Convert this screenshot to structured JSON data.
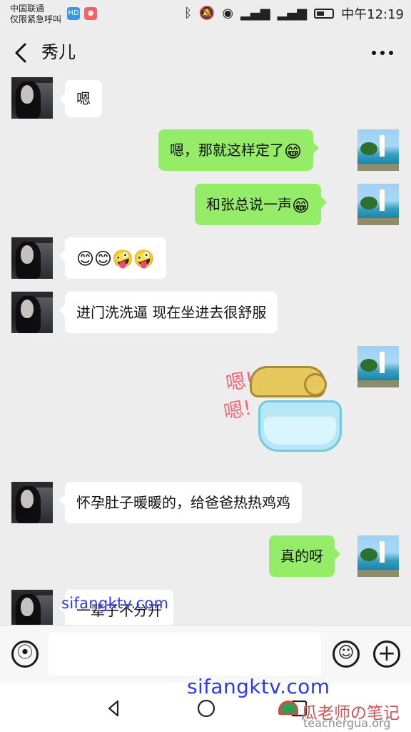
{
  "status_bar": {
    "carrier_line_1": "中国联通",
    "carrier_line_2": "仅限紧急呼叫",
    "badge_1": "HD",
    "badge_2": "",
    "time": "中午12:19",
    "icons": [
      "bluetooth-icon",
      "mute-icon",
      "eye-icon",
      "signal-icon",
      "signal-icon",
      "battery-icon"
    ]
  },
  "header": {
    "title": "秀儿"
  },
  "messages": [
    {
      "side": "left",
      "text": "嗯"
    },
    {
      "side": "right",
      "text": "嗯，那就这样定了",
      "emoji": "😁"
    },
    {
      "side": "right",
      "text": "和张总说一声",
      "emoji": "😁"
    },
    {
      "side": "left",
      "emoji_text": "😊😊🤪🤪"
    },
    {
      "side": "left",
      "text": "进门洗洗逼 现在坐进去很舒服"
    },
    {
      "side": "right",
      "type": "sticker",
      "sticker_text_1": "嗯!",
      "sticker_text_2": "嗯!"
    },
    {
      "side": "left",
      "text": "怀孕肚子暖暖的，给爸爸热热鸡鸡"
    },
    {
      "side": "right",
      "text": "真的呀"
    },
    {
      "side": "left",
      "text": "一辈子不分开"
    }
  ],
  "input": {
    "value": "",
    "placeholder": ""
  },
  "watermarks": {
    "top": "sifangktv.com",
    "bottom": "sifangktv.com",
    "logo_text": "瓜老师の笔记",
    "logo_url": "teachergua.org"
  },
  "colors": {
    "background": "#ededed",
    "green_bubble": "#95ec69",
    "white_bubble": "#ffffff",
    "watermark_blue": "#2d38ff"
  }
}
